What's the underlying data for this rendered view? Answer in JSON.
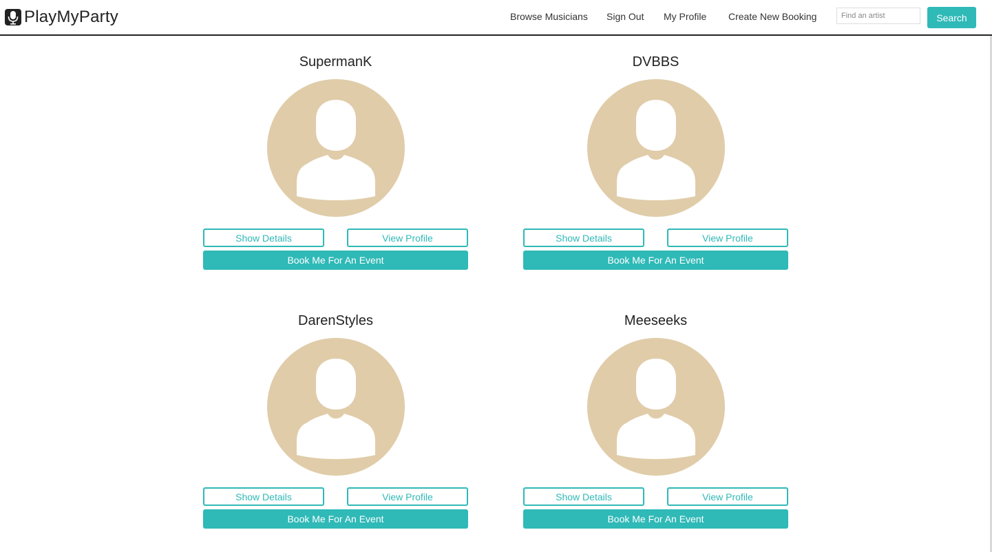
{
  "brand": {
    "name": "PlayMyParty",
    "icon": "microphone-icon"
  },
  "nav": {
    "browse": "Browse Musicians",
    "signout": "Sign Out",
    "profile": "My Profile",
    "create": "Create New Booking"
  },
  "search": {
    "placeholder": "Find an artist",
    "value": "",
    "button": "Search"
  },
  "colors": {
    "accent": "#2fb9b7",
    "avatar": "#e0cca9"
  },
  "musicians": [
    {
      "name": "SupermanK",
      "details_label": "Show Details",
      "profile_label": "View Profile",
      "book_label": "Book Me For An Event"
    },
    {
      "name": "DVBBS",
      "details_label": "Show Details",
      "profile_label": "View Profile",
      "book_label": "Book Me For An Event"
    },
    {
      "name": "DarenStyles",
      "details_label": "Show Details",
      "profile_label": "View Profile",
      "book_label": "Book Me For An Event"
    },
    {
      "name": "Meeseeks",
      "details_label": "Show Details",
      "profile_label": "View Profile",
      "book_label": "Book Me For An Event"
    }
  ]
}
